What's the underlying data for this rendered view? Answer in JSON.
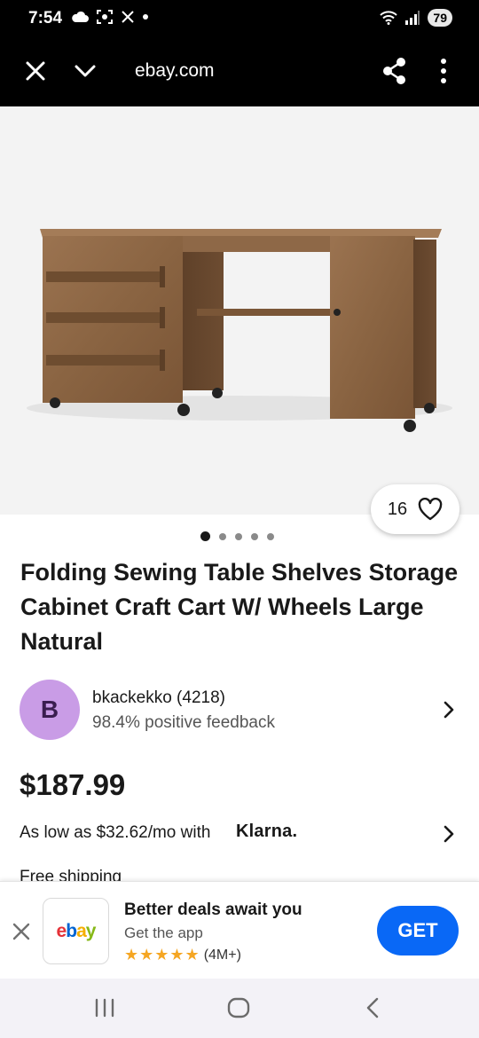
{
  "status_bar": {
    "time": "7:54",
    "left_icons": [
      "cloud-icon",
      "screenshot-icon",
      "x-logo-icon",
      "dot-icon"
    ],
    "right_icons": [
      "wifi-icon",
      "signal-icon"
    ],
    "battery": "79"
  },
  "browser": {
    "url": "ebay.com",
    "icons": [
      "close-icon",
      "chevron-down-icon",
      "share-icon",
      "more-vert-icon"
    ]
  },
  "listing": {
    "like_count": "16",
    "carousel_total": 5,
    "carousel_active": 1,
    "title": "Folding Sewing Table Shelves Storage Cabinet Craft Cart W/ Wheels Large Natural",
    "seller": {
      "initial": "B",
      "name": "bkackekko (4218)",
      "feedback": "98.4% positive feedback"
    },
    "price": "$187.99",
    "klarna_text": "As low as $32.62/mo with",
    "klarna_brand": "Klarna.",
    "shipping": "Free shipping"
  },
  "app_banner": {
    "logo_letters": [
      "e",
      "b",
      "a",
      "y"
    ],
    "title": "Better deals await you",
    "subtitle": "Get the app",
    "stars": "★★★★★",
    "rating_count": "(4M+)",
    "button": "GET"
  },
  "colors": {
    "accent_blue": "#0968f6",
    "avatar_purple": "#c99ce6",
    "star_gold": "#f5a623"
  }
}
